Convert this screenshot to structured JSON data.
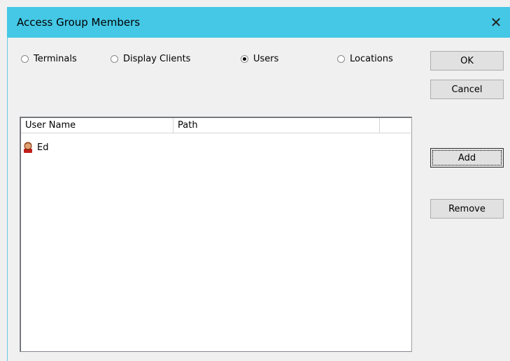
{
  "window": {
    "title": "Access Group Members",
    "close_glyph": "✕",
    "accent": "#44c8e6"
  },
  "radios": [
    {
      "label": "Terminals",
      "checked": false
    },
    {
      "label": "Display Clients",
      "checked": false
    },
    {
      "label": "Users",
      "checked": true
    },
    {
      "label": "Locations",
      "checked": false
    }
  ],
  "buttons": {
    "ok": "OK",
    "cancel": "Cancel",
    "add": "Add",
    "remove": "Remove"
  },
  "list": {
    "columns": [
      "User Name",
      "Path",
      ""
    ],
    "rows": [
      {
        "icon": "user-icon",
        "name": "Ed",
        "path": ""
      }
    ]
  }
}
